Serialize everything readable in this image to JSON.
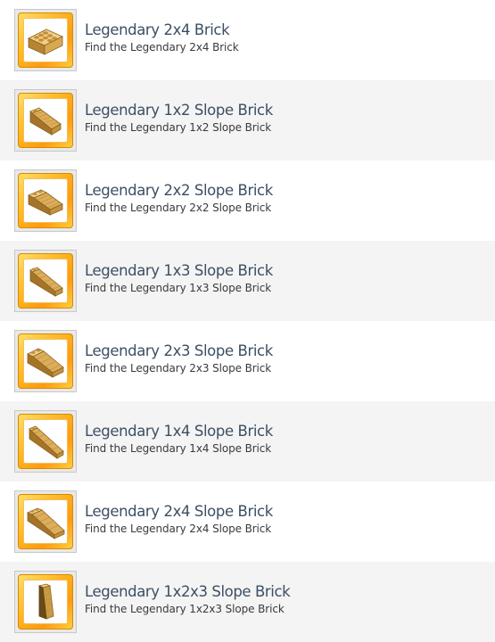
{
  "achievements": [
    {
      "title": "Legendary 2x4 Brick",
      "description": "Find the Legendary 2x4 Brick",
      "icon": "gold-2x4-brick-icon"
    },
    {
      "title": "Legendary 1x2 Slope Brick",
      "description": "Find the Legendary 1x2 Slope Brick",
      "icon": "gold-1x2-slope-brick-icon"
    },
    {
      "title": "Legendary 2x2 Slope Brick",
      "description": "Find the Legendary 2x2 Slope Brick",
      "icon": "gold-2x2-slope-brick-icon"
    },
    {
      "title": "Legendary 1x3 Slope Brick",
      "description": "Find the Legendary 1x3 Slope Brick",
      "icon": "gold-1x3-slope-brick-icon"
    },
    {
      "title": "Legendary 2x3 Slope Brick",
      "description": "Find the Legendary 2x3 Slope Brick",
      "icon": "gold-2x3-slope-brick-icon"
    },
    {
      "title": "Legendary 1x4 Slope Brick",
      "description": "Find the Legendary 1x4 Slope Brick",
      "icon": "gold-1x4-slope-brick-icon"
    },
    {
      "title": "Legendary 2x4 Slope Brick",
      "description": "Find the Legendary 2x4 Slope Brick",
      "icon": "gold-2x4-slope-brick-icon"
    },
    {
      "title": "Legendary 1x2x3 Slope Brick",
      "description": "Find the Legendary 1x2x3 Slope Brick",
      "icon": "gold-1x2x3-slope-brick-icon"
    }
  ],
  "colors": {
    "gold_light": "#f3cf7f",
    "gold_mid": "#c99a45",
    "gold_dark": "#8a6220",
    "frame_orange": "#ffa51a",
    "title_text": "#3b4f64"
  }
}
